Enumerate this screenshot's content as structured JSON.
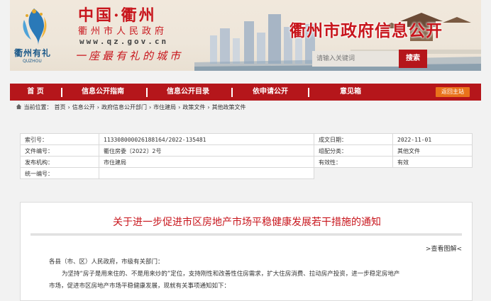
{
  "banner": {
    "logo_text": "衢州有礼",
    "logo_sub": "QUZHOU",
    "title_cn": "中国·衢州",
    "gov_name": "衢州市人民政府",
    "url": "www.qz.gov.cn",
    "slogan": "一座最有礼的城市",
    "site_title": "衢州市政府信息公开"
  },
  "search": {
    "placeholder": "请输入关键词",
    "button_label": "搜索"
  },
  "nav": {
    "items": [
      "首 页",
      "信息公开指南",
      "信息公开目录",
      "依申请公开",
      "意见箱"
    ],
    "home_button": "返回主站"
  },
  "breadcrumb": {
    "prefix": "当前位置：",
    "items": [
      "首页",
      "信息公开",
      "政府信息公开部门",
      "市住建局",
      "政策文件",
      "其他政策文件"
    ],
    "separator": "›"
  },
  "info": {
    "index_label": "索引号：",
    "index_value": "113308000026188164/2022-135481",
    "date_label": "成文日期：",
    "date_value": "2022-11-01",
    "docno_label": "文件编号：",
    "docno_value": "衢住房委〔2022〕2号",
    "category_label": "组配分类：",
    "category_value": "其他文件",
    "org_label": "发布机构：",
    "org_value": "市住建局",
    "validity_label": "有效性：",
    "validity_value": "有效",
    "unified_label": "统一编号：",
    "unified_value": ""
  },
  "article": {
    "title": "关于进一步促进市区房地产市场平稳健康发展若干措施的通知",
    "view_pic": ">查看图解<",
    "greeting": "各县（市、区）人民政府，市级有关部门：",
    "para1": "为坚持“房子是用来住的、不是用来炒的”定位，支持刚性和改善性住房需求，扩大住房消费、拉动房产投资，进一步稳定房地产",
    "para1_cont": "市场，促进市区房地产市场平稳健康发展，现就有关事项通知如下："
  },
  "colors": {
    "brand_red": "#b5161b",
    "title_red": "#c8161d",
    "home_orange": "#e9721b"
  }
}
